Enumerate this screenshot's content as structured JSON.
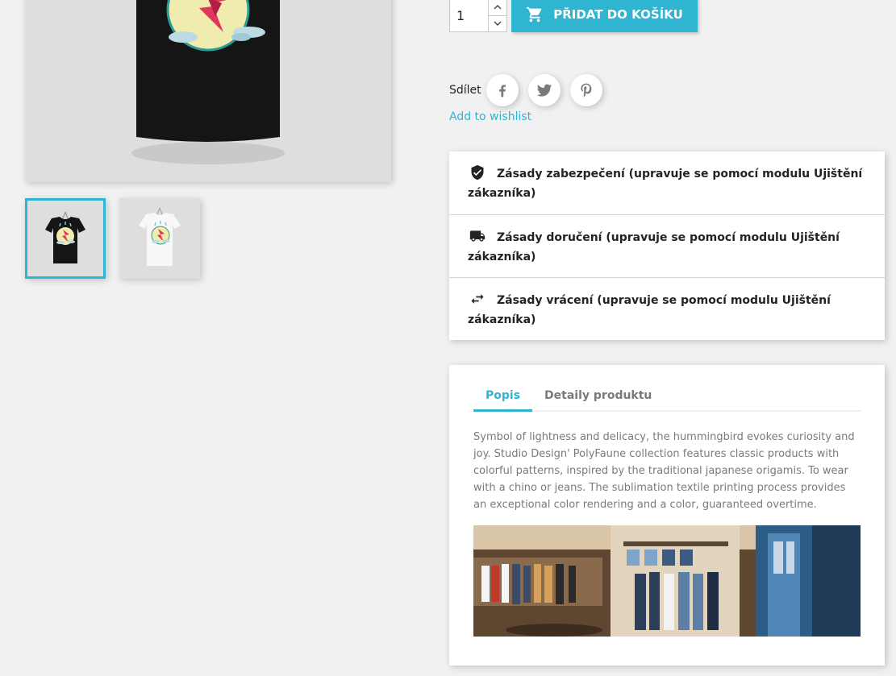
{
  "cart": {
    "quantity": "1",
    "add_label": "PŘIDAT DO KOŠÍKU"
  },
  "share": {
    "label": "Sdílet",
    "networks": [
      "facebook-icon",
      "twitter-icon",
      "pinterest-icon"
    ]
  },
  "wishlist_label": "Add to wishlist",
  "reassurance": [
    {
      "icon": "shield-check-icon",
      "text": "Zásady zabezpečení (upravuje se pomocí modulu Ujištění zákazníka)"
    },
    {
      "icon": "truck-icon",
      "text": "Zásady doručení (upravuje se pomocí modulu Ujištění zákazníka)"
    },
    {
      "icon": "swap-arrows-icon",
      "text": "Zásady vrácení (upravuje se pomocí modulu Ujištění zákazníka)"
    }
  ],
  "tabs": [
    {
      "label": "Popis",
      "active": true
    },
    {
      "label": "Detaily produktu",
      "active": false
    }
  ],
  "description": "Symbol of lightness and delicacy, the hummingbird evokes curiosity and joy. Studio Design' PolyFaune collection features classic products with colorful patterns, inspired by the traditional japanese origamis. To wear with a chino or jeans. The sublimation textile printing process provides an exceptional color rendering and a color, guaranteed overtime.",
  "colors": {
    "accent": "#2fb5d2",
    "background": "#f1f1f1",
    "text": "#232323",
    "muted": "#7a7a7a"
  }
}
